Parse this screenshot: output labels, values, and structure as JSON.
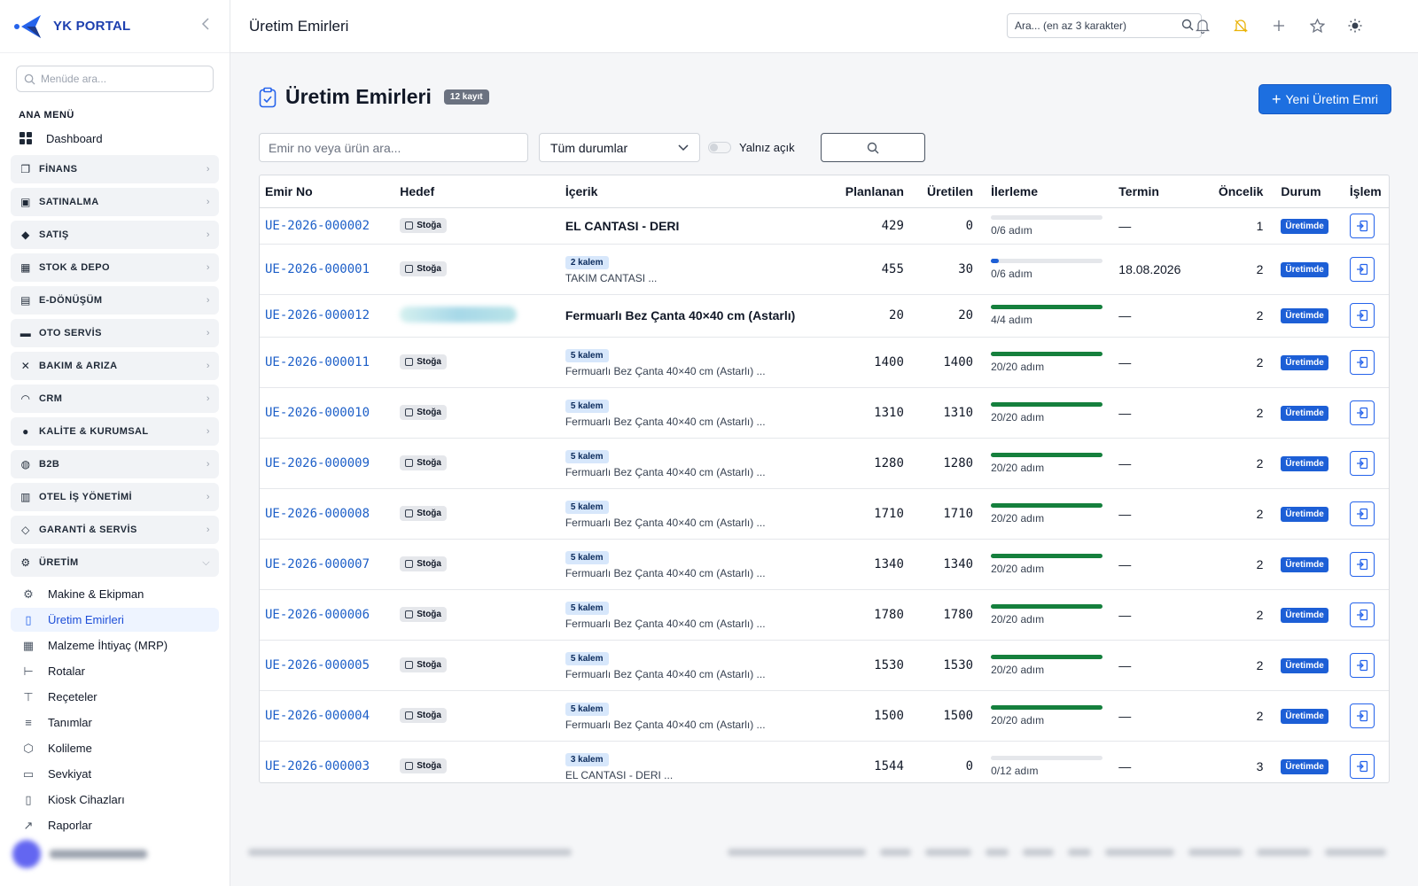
{
  "brand": {
    "title": "YK PORTAL"
  },
  "sidebar": {
    "search_placeholder": "Menüde ara...",
    "caption": "ANA MENÜ",
    "dashboard": "Dashboard",
    "groups": [
      {
        "label": "FİNANS",
        "icon": "finance-icon"
      },
      {
        "label": "SATINALMA",
        "icon": "briefcase-icon"
      },
      {
        "label": "SATIŞ",
        "icon": "tag-icon"
      },
      {
        "label": "STOK & DEPO",
        "icon": "box-icon"
      },
      {
        "label": "E-DÖNÜŞÜM",
        "icon": "document-icon"
      },
      {
        "label": "OTO SERVİS",
        "icon": "car-icon"
      },
      {
        "label": "BAKIM & ARIZA",
        "icon": "tools-icon"
      },
      {
        "label": "CRM",
        "icon": "headset-icon"
      },
      {
        "label": "KALİTE & KURUMSAL",
        "icon": "badge-icon"
      },
      {
        "label": "B2B",
        "icon": "globe-icon"
      },
      {
        "label": "OTEL İŞ YÖNETİMİ",
        "icon": "building-icon"
      },
      {
        "label": "GARANTİ & SERVİS",
        "icon": "shield-icon"
      },
      {
        "label": "ÜRETİM",
        "icon": "gear-icon"
      }
    ],
    "sub_items": [
      {
        "label": "Makine & Ekipman",
        "icon": "machine-icon"
      },
      {
        "label": "Üretim Emirleri",
        "icon": "clipboard-icon"
      },
      {
        "label": "Malzeme İhtiyaç (MRP)",
        "icon": "calculator-icon"
      },
      {
        "label": "Rotalar",
        "icon": "signpost-icon"
      },
      {
        "label": "Reçeteler",
        "icon": "hierarchy-icon"
      },
      {
        "label": "Tanımlar",
        "icon": "sliders-icon"
      },
      {
        "label": "Kolileme",
        "icon": "package-icon"
      },
      {
        "label": "Sevkiyat",
        "icon": "truck-icon"
      },
      {
        "label": "Kiosk Cihazları",
        "icon": "tablet-icon"
      },
      {
        "label": "Raporlar",
        "icon": "chart-icon"
      }
    ]
  },
  "topbar": {
    "title": "Üretim Emirleri",
    "search_placeholder": "Ara... (en az 3 karakter)"
  },
  "page": {
    "title": "Üretim Emirleri",
    "count_badge": "12 kayıt",
    "new_button": "Yeni Üretim Emri"
  },
  "filters": {
    "search_placeholder": "Emir no veya ürün ara...",
    "status_select": "Tüm durumlar",
    "toggle_label": "Yalnız açık"
  },
  "table": {
    "headers": [
      "Emir No",
      "Hedef",
      "İçerik",
      "Planlanan",
      "Üretilen",
      "İlerleme",
      "Termin",
      "Öncelik",
      "Durum",
      "İşlem"
    ],
    "rows": [
      {
        "no": "UE-2026-000002",
        "hedef": "Stoğa",
        "kalem": "",
        "content": "EL CANTASI - DERI",
        "content_bold": true,
        "planlanan": "429",
        "uretilen": "0",
        "progress": 0.0,
        "progress_text": "0/6 adım",
        "termin": "—",
        "oncelik": "1",
        "durum": "Üretimde"
      },
      {
        "no": "UE-2026-000001",
        "hedef": "Stoğa",
        "kalem": "2 kalem",
        "content": "TAKIM CANTASI ...",
        "content_bold": false,
        "planlanan": "455",
        "uretilen": "30",
        "progress": 0.07,
        "progress_text": "0/6 adım",
        "termin": "18.08.2026",
        "oncelik": "2",
        "durum": "Üretimde"
      },
      {
        "no": "UE-2026-000012",
        "hedef": "",
        "kalem": "",
        "content": "Fermuarlı Bez Çanta 40×40 cm (Astarlı)",
        "content_bold": true,
        "planlanan": "20",
        "uretilen": "20",
        "progress": 1.0,
        "progress_text": "4/4 adım",
        "termin": "—",
        "oncelik": "2",
        "durum": "Üretimde"
      },
      {
        "no": "UE-2026-000011",
        "hedef": "Stoğa",
        "kalem": "5 kalem",
        "content": "Fermuarlı Bez Çanta 40×40 cm (Astarlı) ...",
        "content_bold": false,
        "planlanan": "1400",
        "uretilen": "1400",
        "progress": 1.0,
        "progress_text": "20/20 adım",
        "termin": "—",
        "oncelik": "2",
        "durum": "Üretimde"
      },
      {
        "no": "UE-2026-000010",
        "hedef": "Stoğa",
        "kalem": "5 kalem",
        "content": "Fermuarlı Bez Çanta 40×40 cm (Astarlı) ...",
        "content_bold": false,
        "planlanan": "1310",
        "uretilen": "1310",
        "progress": 1.0,
        "progress_text": "20/20 adım",
        "termin": "—",
        "oncelik": "2",
        "durum": "Üretimde"
      },
      {
        "no": "UE-2026-000009",
        "hedef": "Stoğa",
        "kalem": "5 kalem",
        "content": "Fermuarlı Bez Çanta 40×40 cm (Astarlı) ...",
        "content_bold": false,
        "planlanan": "1280",
        "uretilen": "1280",
        "progress": 1.0,
        "progress_text": "20/20 adım",
        "termin": "—",
        "oncelik": "2",
        "durum": "Üretimde"
      },
      {
        "no": "UE-2026-000008",
        "hedef": "Stoğa",
        "kalem": "5 kalem",
        "content": "Fermuarlı Bez Çanta 40×40 cm (Astarlı) ...",
        "content_bold": false,
        "planlanan": "1710",
        "uretilen": "1710",
        "progress": 1.0,
        "progress_text": "20/20 adım",
        "termin": "—",
        "oncelik": "2",
        "durum": "Üretimde"
      },
      {
        "no": "UE-2026-000007",
        "hedef": "Stoğa",
        "kalem": "5 kalem",
        "content": "Fermuarlı Bez Çanta 40×40 cm (Astarlı) ...",
        "content_bold": false,
        "planlanan": "1340",
        "uretilen": "1340",
        "progress": 1.0,
        "progress_text": "20/20 adım",
        "termin": "—",
        "oncelik": "2",
        "durum": "Üretimde"
      },
      {
        "no": "UE-2026-000006",
        "hedef": "Stoğa",
        "kalem": "5 kalem",
        "content": "Fermuarlı Bez Çanta 40×40 cm (Astarlı) ...",
        "content_bold": false,
        "planlanan": "1780",
        "uretilen": "1780",
        "progress": 1.0,
        "progress_text": "20/20 adım",
        "termin": "—",
        "oncelik": "2",
        "durum": "Üretimde"
      },
      {
        "no": "UE-2026-000005",
        "hedef": "Stoğa",
        "kalem": "5 kalem",
        "content": "Fermuarlı Bez Çanta 40×40 cm (Astarlı) ...",
        "content_bold": false,
        "planlanan": "1530",
        "uretilen": "1530",
        "progress": 1.0,
        "progress_text": "20/20 adım",
        "termin": "—",
        "oncelik": "2",
        "durum": "Üretimde"
      },
      {
        "no": "UE-2026-000004",
        "hedef": "Stoğa",
        "kalem": "5 kalem",
        "content": "Fermuarlı Bez Çanta 40×40 cm (Astarlı) ...",
        "content_bold": false,
        "planlanan": "1500",
        "uretilen": "1500",
        "progress": 1.0,
        "progress_text": "20/20 adım",
        "termin": "—",
        "oncelik": "2",
        "durum": "Üretimde"
      },
      {
        "no": "UE-2026-000003",
        "hedef": "Stoğa",
        "kalem": "3 kalem",
        "content": "EL CANTASI - DERI ...",
        "content_bold": false,
        "planlanan": "1544",
        "uretilen": "0",
        "progress": 0.0,
        "progress_text": "0/12 adım",
        "termin": "—",
        "oncelik": "3",
        "durum": "Üretimde"
      }
    ]
  },
  "colors": {
    "accent": "#1d6fe0",
    "progress_complete": "#15803d",
    "progress_partial": "#1d5fd6",
    "status_badge": "#1d5fd6"
  }
}
